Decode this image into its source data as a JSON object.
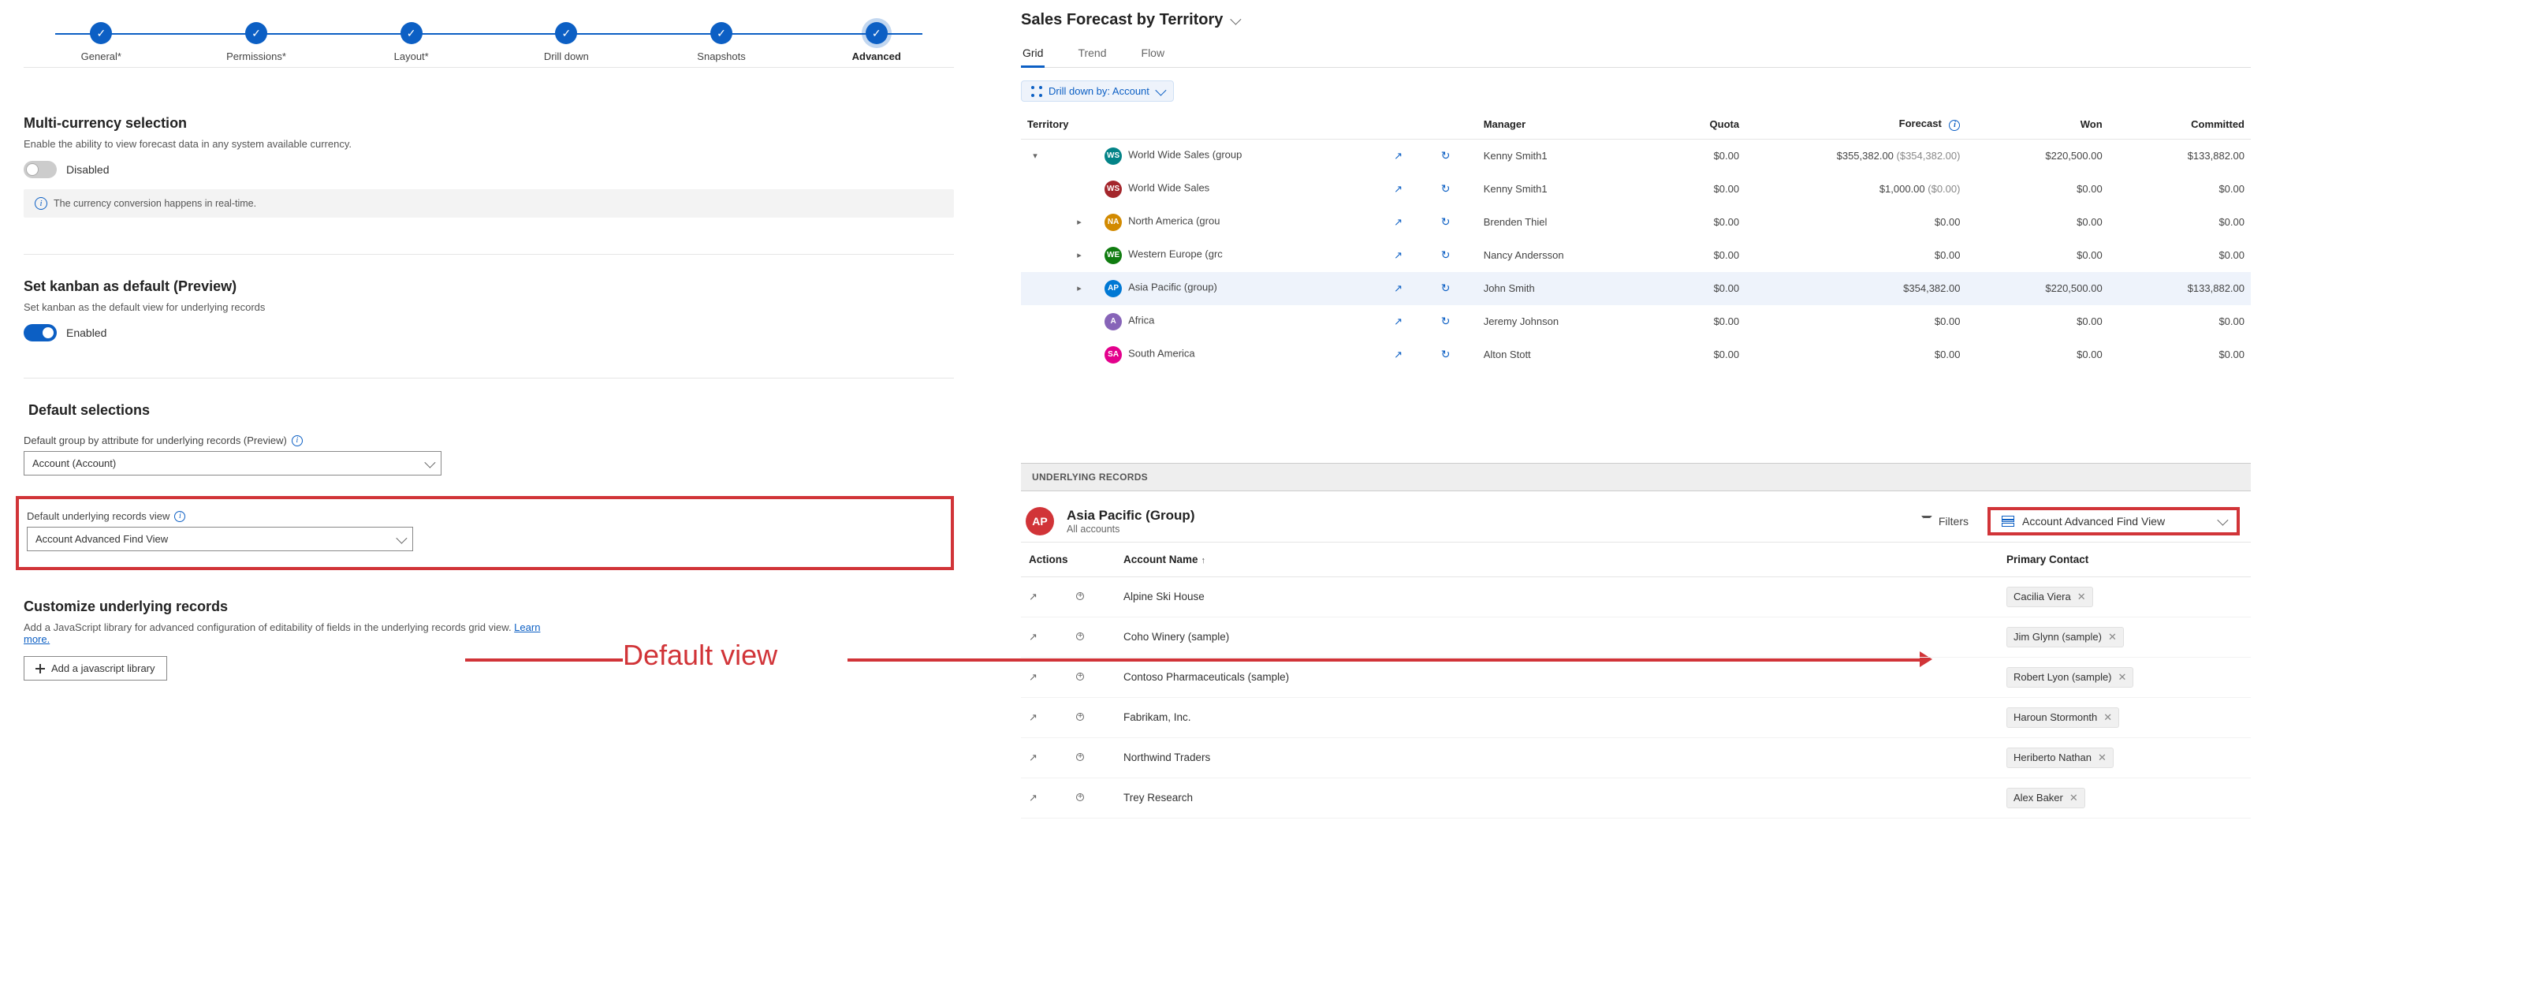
{
  "stepper": {
    "steps": [
      {
        "label": "General*"
      },
      {
        "label": "Permissions*"
      },
      {
        "label": "Layout*"
      },
      {
        "label": "Drill down"
      },
      {
        "label": "Snapshots"
      },
      {
        "label": "Advanced"
      }
    ]
  },
  "multi_currency": {
    "title": "Multi-currency selection",
    "desc": "Enable the ability to view forecast data in any system available currency.",
    "toggle_label": "Disabled",
    "info": "The currency conversion happens in real-time."
  },
  "kanban": {
    "title": "Set kanban as default (Preview)",
    "desc": "Set kanban as the default view for underlying records",
    "toggle_label": "Enabled"
  },
  "default_selections": {
    "title": "Default selections",
    "group_by_label": "Default group by attribute for underlying records (Preview)",
    "group_by_value": "Account (Account)",
    "view_label": "Default underlying records view",
    "view_value": "Account Advanced Find View"
  },
  "customize": {
    "title": "Customize underlying records",
    "desc_a": "Add a JavaScript library for advanced configuration of editability of fields in the underlying records grid view. ",
    "learn_more": "Learn more.",
    "button": "Add a javascript library"
  },
  "annotation": "Default view",
  "forecast": {
    "title": "Sales Forecast by Territory",
    "tabs": [
      "Grid",
      "Trend",
      "Flow"
    ],
    "drill_label": "Drill down by: Account",
    "columns": {
      "territory": "Territory",
      "manager": "Manager",
      "quota": "Quota",
      "forecast": "Forecast",
      "won": "Won",
      "committed": "Committed"
    },
    "rows": [
      {
        "indent": 0,
        "expand": "open",
        "avatar": "WS",
        "color": "#038387",
        "territory": "World Wide Sales (group",
        "manager": "Kenny Smith1",
        "quota": "$0.00",
        "forecast": "$355,382.00",
        "forecast_paren": "($354,382.00)",
        "won": "$220,500.00",
        "committed": "$133,882.00"
      },
      {
        "indent": 1,
        "expand": "",
        "avatar": "WS",
        "color": "#a4262c",
        "territory": "World Wide Sales",
        "manager": "Kenny Smith1",
        "quota": "$0.00",
        "forecast": "$1,000.00",
        "forecast_paren": "($0.00)",
        "won": "$0.00",
        "committed": "$0.00"
      },
      {
        "indent": 1,
        "expand": "closed",
        "avatar": "NA",
        "color": "#d28a00",
        "territory": "North America (grou",
        "manager": "Brenden Thiel",
        "quota": "$0.00",
        "forecast": "$0.00",
        "forecast_paren": "",
        "won": "$0.00",
        "committed": "$0.00"
      },
      {
        "indent": 1,
        "expand": "closed",
        "avatar": "WE",
        "color": "#107c10",
        "territory": "Western Europe (grc",
        "manager": "Nancy Andersson",
        "quota": "$0.00",
        "forecast": "$0.00",
        "forecast_paren": "",
        "won": "$0.00",
        "committed": "$0.00"
      },
      {
        "indent": 1,
        "expand": "closed",
        "avatar": "AP",
        "color": "#0078d4",
        "territory": "Asia Pacific (group)",
        "manager": "John Smith",
        "quota": "$0.00",
        "forecast": "$354,382.00",
        "forecast_paren": "",
        "won": "$220,500.00",
        "committed": "$133,882.00",
        "selected": true
      },
      {
        "indent": 1,
        "expand": "",
        "avatar": "A",
        "color": "#8764b8",
        "territory": "Africa",
        "manager": "Jeremy Johnson",
        "quota": "$0.00",
        "forecast": "$0.00",
        "forecast_paren": "",
        "won": "$0.00",
        "committed": "$0.00"
      },
      {
        "indent": 1,
        "expand": "",
        "avatar": "SA",
        "color": "#e3008c",
        "territory": "South America",
        "manager": "Alton Stott",
        "quota": "$0.00",
        "forecast": "$0.00",
        "forecast_paren": "",
        "won": "$0.00",
        "committed": "$0.00"
      }
    ]
  },
  "underlying": {
    "bar": "UNDERLYING RECORDS",
    "avatar": "AP",
    "title": "Asia Pacific (Group)",
    "sub": "All accounts",
    "filters": "Filters",
    "view": "Account Advanced Find View",
    "columns": {
      "actions": "Actions",
      "account": "Account Name",
      "contact": "Primary Contact"
    },
    "rows": [
      {
        "account": "Alpine Ski House",
        "contact": "Cacilia Viera"
      },
      {
        "account": "Coho Winery (sample)",
        "contact": "Jim Glynn (sample)"
      },
      {
        "account": "Contoso Pharmaceuticals (sample)",
        "contact": "Robert Lyon (sample)"
      },
      {
        "account": "Fabrikam, Inc.",
        "contact": "Haroun Stormonth"
      },
      {
        "account": "Northwind Traders",
        "contact": "Heriberto Nathan"
      },
      {
        "account": "Trey Research",
        "contact": "Alex Baker"
      }
    ]
  }
}
